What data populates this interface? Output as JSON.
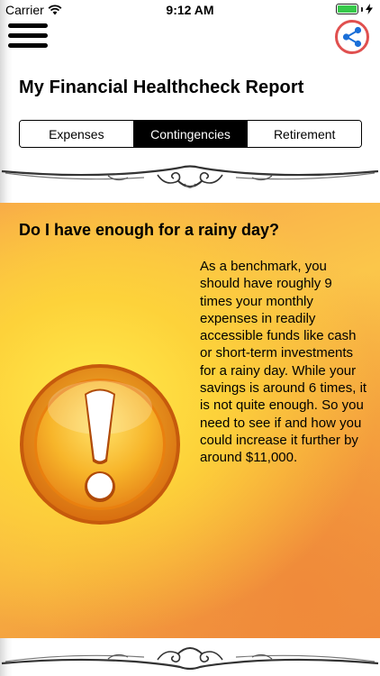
{
  "status_bar": {
    "carrier": "Carrier",
    "time": "9:12 AM",
    "battery_level": 1.0
  },
  "header": {
    "menu_icon": "hamburger-menu-icon",
    "share_icon": "share-icon",
    "title": "My Financial Healthcheck Report"
  },
  "tabs": [
    {
      "label": "Expenses",
      "active": false
    },
    {
      "label": "Contingencies",
      "active": true
    },
    {
      "label": "Retirement",
      "active": false
    }
  ],
  "card": {
    "heading": "Do I have enough for a rainy day?",
    "body": "As a benchmark, you should have roughly 9 times your monthly expenses in readily accessible funds like cash or short-term investments for a rainy day. While your savings is around 6 times, it is not quite enough. So you need to see if and how you could increase it further by around $11,000.",
    "icon": "exclamation-warning-icon"
  },
  "colors": {
    "accent_red": "#e0504f",
    "share_blue": "#1a6fd8",
    "battery_green": "#36c94a",
    "card_yellow": "#fdd23a",
    "card_orange": "#ef8a3e"
  }
}
